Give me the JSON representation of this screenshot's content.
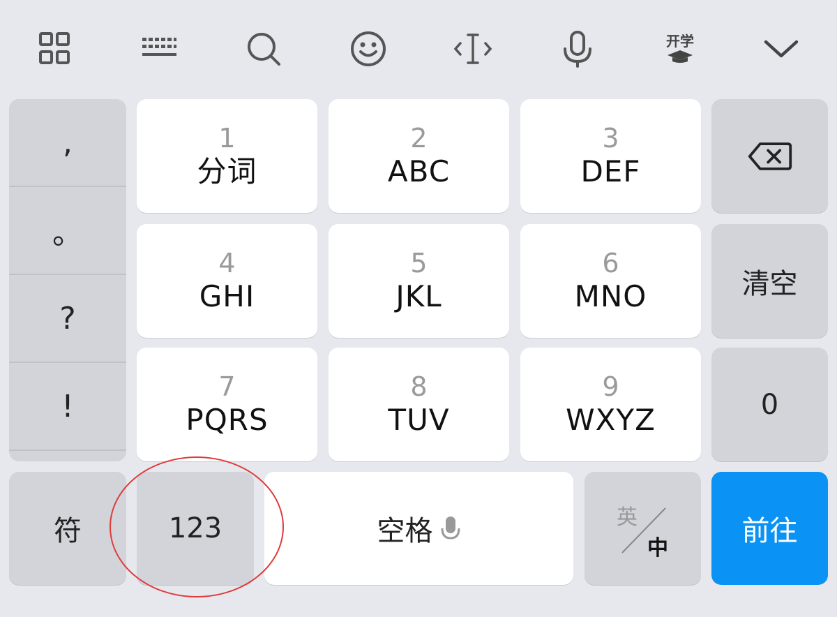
{
  "toolbar": {
    "icons": [
      "apps-grid-icon",
      "keyboard-icon",
      "search-icon",
      "emoji-icon",
      "cursor-icon",
      "microphone-icon",
      "study-icon",
      "collapse-chevron-icon"
    ],
    "study_label": "开学"
  },
  "punctuation": [
    ",",
    "。",
    "?",
    "!"
  ],
  "keys": [
    {
      "num": "1",
      "letters": "分词"
    },
    {
      "num": "2",
      "letters": "ABC"
    },
    {
      "num": "3",
      "letters": "DEF"
    },
    {
      "num": "4",
      "letters": "GHI"
    },
    {
      "num": "5",
      "letters": "JKL"
    },
    {
      "num": "6",
      "letters": "MNO"
    },
    {
      "num": "7",
      "letters": "PQRS"
    },
    {
      "num": "8",
      "letters": "TUV"
    },
    {
      "num": "9",
      "letters": "WXYZ"
    }
  ],
  "right_column": {
    "clear": "清空",
    "zero": "0"
  },
  "bottom_row": {
    "symbols": "符",
    "numbers": "123",
    "space": "空格",
    "lang_top": "英",
    "lang_bottom": "中",
    "go": "前往"
  },
  "colors": {
    "accent": "#0a93f5",
    "background": "#e6e8ed",
    "highlight_circle": "#e03a3a"
  }
}
